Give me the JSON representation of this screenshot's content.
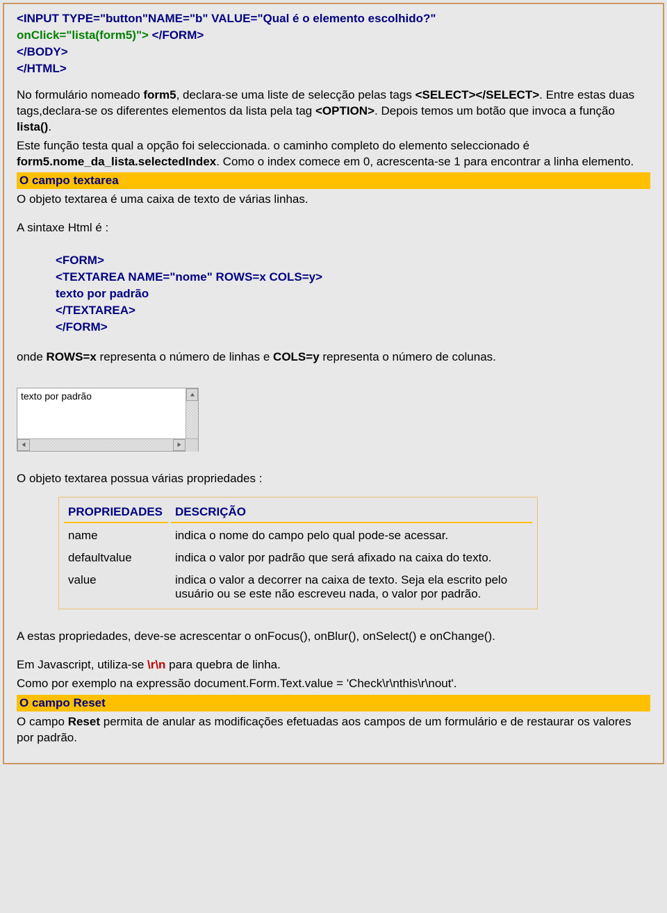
{
  "code_top": {
    "line1a": "<INPUT TYPE=\"button\"NAME=\"b\" VALUE=\"Qual é o elemento escolhido?\"",
    "line2_green": "onClick=\"lista(form5)\">",
    "line2_navy": " </FORM>",
    "line3": "</BODY>",
    "line4": "</HTML>"
  },
  "para1": {
    "a": "No formulário nomeado ",
    "b": "form5",
    "c": ", declara-se uma liste de selecção pelas tags ",
    "d": "<SELECT></SELECT>",
    "e": ". Entre estas duas tags,declara-se os diferentes elementos da lista pela tag ",
    "f": "<OPTION>",
    "g": ". Depois temos um botão que invoca a função ",
    "h": "lista()",
    "i": "."
  },
  "para2": {
    "a": "Este função testa qual a opção foi seleccionada. o caminho completo do elemento seleccionado é ",
    "b": "form5.nome_da_lista.selectedIndex",
    "c": ". Como o index comece em 0, acrescenta-se 1 para encontrar a linha elemento."
  },
  "heading_textarea": "O campo textarea",
  "textarea_desc": "O objeto textarea é uma caixa de texto de várias linhas.",
  "syntax_label": "A sintaxe Html é :",
  "syntax_block": {
    "l1": "<FORM>",
    "l2": "<TEXTAREA NAME=\"nome\" ROWS=x COLS=y>",
    "l3": "texto por padrão",
    "l4": "</TEXTAREA>",
    "l5": "</FORM>"
  },
  "rows_cols": {
    "a": "onde ",
    "b": "ROWS=x",
    "c": " representa o número de linhas e ",
    "d": "COLS=y",
    "e": " representa o número de colunas."
  },
  "textarea_value": "texto por padrão",
  "props_intro": "O objeto textarea possua várias propriedades :",
  "table": {
    "h1": "PROPRIEDADES",
    "h2": "DESCRIÇÃO",
    "rows": [
      {
        "p": "name",
        "d": "indica o nome do campo pelo qual pode-se acessar."
      },
      {
        "p": "defaultvalue",
        "d": "indica o valor por padrão que será afixado na caixa do texto."
      },
      {
        "p": "value",
        "d": "indica o valor a decorrer na caixa de texto. Seja ela escrito pelo usuário ou se este não escreveu nada, o valor por padrão."
      }
    ]
  },
  "after_table": "A estas propriedades, deve-se acrescentar o onFocus(), onBlur(), onSelect() e onChange().",
  "linebreak": {
    "a": "Em Javascript, utiliza-se ",
    "b": "\\r\\n",
    "c": " para quebra de linha."
  },
  "example": "Como por exemplo na expressão document.Form.Text.value = 'Check\\r\\nthis\\r\\nout'.",
  "heading_reset": "O campo Reset",
  "reset_desc": {
    "a": "O campo ",
    "b": "Reset",
    "c": " permita de anular as modificações efetuadas aos campos de um formulário e de restaurar os valores por padrão."
  }
}
